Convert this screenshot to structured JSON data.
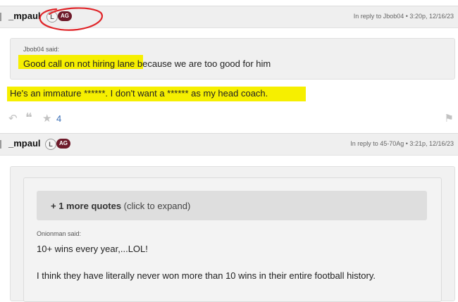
{
  "posts": [
    {
      "username": "_mpaul",
      "badge_l": "L",
      "badge_ag": "AG",
      "reply_meta": "In reply to Jbob04 • 3:20p, 12/16/23",
      "quote": {
        "author": "Jbob04 said:",
        "text": "Good call on not hiring lane because we are too good for him"
      },
      "body": "He's an immature ******. I don't want a ****** as my head coach.",
      "likes": "4"
    },
    {
      "username": "_mpaul",
      "badge_l": "L",
      "badge_ag": "AG",
      "reply_meta": "In reply to 45-70Ag • 3:21p, 12/16/23",
      "expand": {
        "strong": "+ 1 more quotes",
        "rest": " (click to expand)"
      },
      "quote": {
        "author": "Onionman said:",
        "line1": "10+ wins every year,...LOL!",
        "line2": "I think they have literally never won more than 10 wins in their entire football history."
      }
    }
  ],
  "icons": {
    "reply": "reply-icon",
    "quote": "quote-icon",
    "like": "star-icon",
    "flag": "flag-icon"
  },
  "colors": {
    "highlight": "#f6ef00",
    "annotation_circle": "#e0262a",
    "ag_badge": "#6e1a2a",
    "like_count": "#3b6fb6"
  }
}
